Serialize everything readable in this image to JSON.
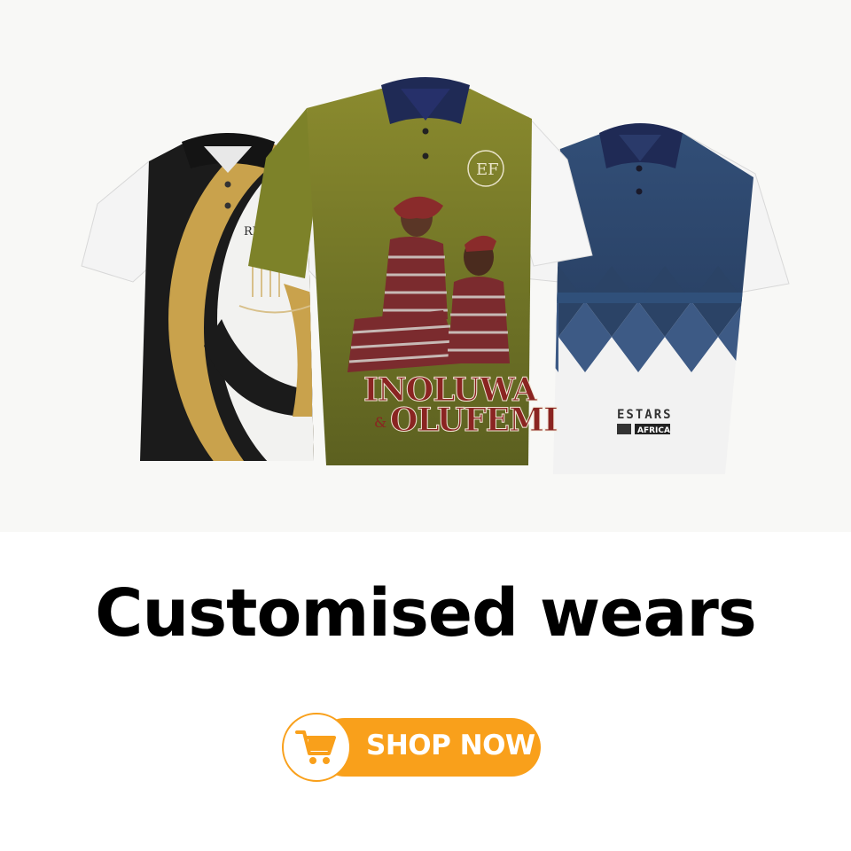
{
  "hero": {
    "shirts": [
      {
        "name": "black-gold-polo",
        "print_text": "RIPC"
      },
      {
        "name": "olive-portrait-polo",
        "print_line1": "INOLUWA",
        "print_amp": "&",
        "print_line2": "OLUFEMI",
        "monogram": "EF"
      },
      {
        "name": "navy-diamond-polo",
        "brand_line1": "ESTARS",
        "brand_line2": "AFRICA"
      }
    ]
  },
  "headline": "Customised wears",
  "cta": {
    "label": "SHOP NOW",
    "icon": "cart-icon"
  },
  "colors": {
    "accent": "#f9a01b",
    "gold": "#c8a24a",
    "olive": "#7a7f2a",
    "navy": "#2f4f75",
    "collar_navy": "#1f2a55"
  }
}
